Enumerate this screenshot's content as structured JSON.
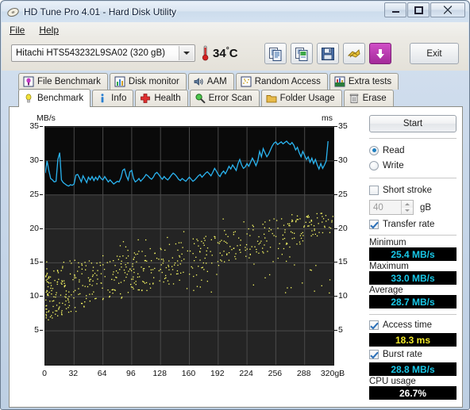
{
  "window": {
    "title": "HD Tune Pro 4.01 - Hard Disk Utility",
    "icon": "hdtune-logo-icon",
    "minimize_label": "—",
    "maximize_label": "▭",
    "close_label": "✕"
  },
  "menu": {
    "items": [
      {
        "label": "File",
        "mnemonic": "F"
      },
      {
        "label": "Help",
        "mnemonic": "H"
      }
    ]
  },
  "toolbar": {
    "drive": {
      "selected": "Hitachi HTS543232L9SA02  (320 gB)",
      "options": [
        "Hitachi HTS543232L9SA02  (320 gB)"
      ]
    },
    "temperature": {
      "value": "34",
      "degree": "°",
      "unit": "C",
      "display": "34°C"
    },
    "buttons": [
      {
        "name": "copy-icon",
        "title": "Copy"
      },
      {
        "name": "copy-image-icon",
        "title": "Copy screenshot"
      },
      {
        "name": "save-icon",
        "title": "Save"
      },
      {
        "name": "accelerate-icon",
        "title": "Options"
      },
      {
        "name": "download-icon",
        "title": "Download"
      }
    ],
    "exit_label": "Exit"
  },
  "tabs": {
    "row1": [
      {
        "label": "File Benchmark",
        "icon": "file-benchmark-icon",
        "active": false
      },
      {
        "label": "Disk monitor",
        "icon": "disk-monitor-icon",
        "active": false
      },
      {
        "label": "AAM",
        "icon": "aam-speaker-icon",
        "active": false
      },
      {
        "label": "Random Access",
        "icon": "random-access-icon",
        "active": false
      },
      {
        "label": "Extra tests",
        "icon": "extra-tests-icon",
        "active": false
      }
    ],
    "row2": [
      {
        "label": "Benchmark",
        "icon": "benchmark-bulb-icon",
        "active": true
      },
      {
        "label": "Info",
        "icon": "info-icon",
        "active": false
      },
      {
        "label": "Health",
        "icon": "health-cross-icon",
        "active": false
      },
      {
        "label": "Error Scan",
        "icon": "error-scan-magnifier-icon",
        "active": false
      },
      {
        "label": "Folder Usage",
        "icon": "folder-usage-icon",
        "active": false
      },
      {
        "label": "Erase",
        "icon": "erase-trash-icon",
        "active": false
      }
    ]
  },
  "controls": {
    "start_label": "Start",
    "mode": {
      "read_label": "Read",
      "write_label": "Write",
      "selected": "Read"
    },
    "short_stroke": {
      "label": "Short stroke",
      "checked": false
    },
    "short_stroke_size": {
      "value": "40",
      "unit_label": "gB",
      "enabled": false
    },
    "transfer_rate": {
      "label": "Transfer rate",
      "checked": true
    },
    "access_time": {
      "label": "Access time",
      "checked": true
    },
    "burst_rate": {
      "label": "Burst rate",
      "checked": true
    }
  },
  "results": {
    "minimum": {
      "label": "Minimum",
      "value": "25.4 MB/s"
    },
    "maximum": {
      "label": "Maximum",
      "value": "33.0 MB/s"
    },
    "average": {
      "label": "Average",
      "value": "28.7 MB/s"
    },
    "access_time": {
      "label": "Access time",
      "value": "18.3 ms"
    },
    "burst_rate": {
      "label": "Burst rate",
      "value": "28.8 MB/s"
    },
    "cpu_usage": {
      "label": "CPU usage",
      "value": "26.7%"
    }
  },
  "chart_data": {
    "type": "line",
    "title": "",
    "ylabel": "MB/s",
    "ylabel_right": "ms",
    "xlabel": "",
    "xlim": [
      0,
      320
    ],
    "ylim": [
      0,
      35
    ],
    "ylim_right": [
      0,
      35
    ],
    "xticks": [
      0,
      32,
      64,
      96,
      128,
      160,
      192,
      224,
      256,
      288,
      320
    ],
    "xtick_labels": [
      "0",
      "32",
      "64",
      "96",
      "128",
      "160",
      "192",
      "224",
      "256",
      "288",
      "320gB"
    ],
    "yticks": [
      5,
      10,
      15,
      20,
      25,
      30,
      35
    ],
    "ytick_labels": [
      "5",
      "10",
      "15",
      "20",
      "25",
      "30",
      "35"
    ],
    "yticks_right": [
      5,
      10,
      15,
      20,
      25,
      30,
      35
    ],
    "ytick_labels_right": [
      "5",
      "10",
      "15",
      "20",
      "25",
      "30",
      "35"
    ],
    "grid": true,
    "grid_color": "#4a4a4a",
    "background": "#0a0a0a",
    "legend": "none",
    "series": [
      {
        "name": "Transfer rate",
        "type": "line",
        "color": "#2ab4f0",
        "axis": "left",
        "units": "MB/s",
        "x": [
          0,
          2,
          4,
          6,
          8,
          10,
          12,
          14,
          16,
          18,
          20,
          22,
          24,
          26,
          28,
          30,
          32,
          34,
          36,
          38,
          40,
          42,
          44,
          46,
          48,
          50,
          52,
          54,
          56,
          58,
          60,
          62,
          64,
          66,
          68,
          70,
          72,
          74,
          76,
          78,
          80,
          82,
          84,
          86,
          88,
          90,
          92,
          94,
          96,
          98,
          100,
          102,
          104,
          106,
          108,
          110,
          112,
          114,
          116,
          118,
          120,
          122,
          124,
          126,
          128,
          130,
          132,
          134,
          136,
          138,
          140,
          142,
          144,
          146,
          148,
          150,
          152,
          154,
          156,
          158,
          160,
          162,
          164,
          166,
          168,
          170,
          172,
          174,
          176,
          178,
          180,
          182,
          184,
          186,
          188,
          190,
          192,
          194,
          196,
          198,
          200,
          202,
          204,
          206,
          208,
          210,
          212,
          214,
          216,
          218,
          220,
          222,
          224,
          226,
          228,
          230,
          232,
          234,
          236,
          238,
          240,
          242,
          244,
          246,
          248,
          250,
          252,
          254,
          256,
          258,
          260,
          262,
          264,
          266,
          268,
          270,
          272,
          274,
          276,
          278,
          280,
          282,
          284,
          286,
          288,
          290,
          292,
          294,
          296,
          298,
          300,
          302,
          304,
          306,
          308,
          310,
          312,
          314,
          316,
          318,
          320
        ],
        "values": [
          28.2,
          30.0,
          28.6,
          27.4,
          27.2,
          26.9,
          27.0,
          30.2,
          31.2,
          27.2,
          26.8,
          26.6,
          26.4,
          26.3,
          26.5,
          26.4,
          26.6,
          27.9,
          28.0,
          27.5,
          26.9,
          27.8,
          27.3,
          26.8,
          27.6,
          27.2,
          27.7,
          27.1,
          27.6,
          27.2,
          27.8,
          27.4,
          27.2,
          27.7,
          27.3,
          26.9,
          27.2,
          26.9,
          26.6,
          26.8,
          27.0,
          26.9,
          27.5,
          28.6,
          28.8,
          27.8,
          27.2,
          28.4,
          28.6,
          27.4,
          26.9,
          27.1,
          27.4,
          27.0,
          27.3,
          27.6,
          28.0,
          27.8,
          27.5,
          27.3,
          27.6,
          28.1,
          28.3,
          28.0,
          27.6,
          27.3,
          27.7,
          27.4,
          27.2,
          27.5,
          27.9,
          28.2,
          28.0,
          27.7,
          27.3,
          27.1,
          27.4,
          27.2,
          27.0,
          27.3,
          27.6,
          27.3,
          27.0,
          27.2,
          27.5,
          27.8,
          28.0,
          27.6,
          27.9,
          28.2,
          28.4,
          28.1,
          27.8,
          28.3,
          28.9,
          28.5,
          28.0,
          27.7,
          28.2,
          28.5,
          28.1,
          28.6,
          29.2,
          28.8,
          29.4,
          29.0,
          28.6,
          29.6,
          30.2,
          29.4,
          28.9,
          29.1,
          29.6,
          29.2,
          29.8,
          30.4,
          29.9,
          29.3,
          30.0,
          31.4,
          30.6,
          31.8,
          31.2,
          30.6,
          31.0,
          31.6,
          32.2,
          32.6,
          32.8,
          32.4,
          32.6,
          32.8,
          32.5,
          32.7,
          32.9,
          32.6,
          32.4,
          32.7,
          32.3,
          31.6,
          32.0,
          31.2,
          30.6,
          31.4,
          30.8,
          30.2,
          30.6,
          29.8,
          30.4,
          29.6,
          30.2,
          29.4,
          28.8,
          29.6,
          28.9,
          29.4,
          30.0,
          32.9
        ]
      },
      {
        "name": "Access time",
        "type": "scatter",
        "color": "#ffff66",
        "axis": "right",
        "units": "ms",
        "description": "Yellow dot cloud rising from about 7 ms at 0 gB to about 22 ms, densest between 0 and 190 gB, thinning toward 320 gB",
        "range_ms": [
          6.5,
          22.5
        ],
        "mean_ms": 18.3,
        "point_count": 600
      }
    ]
  }
}
